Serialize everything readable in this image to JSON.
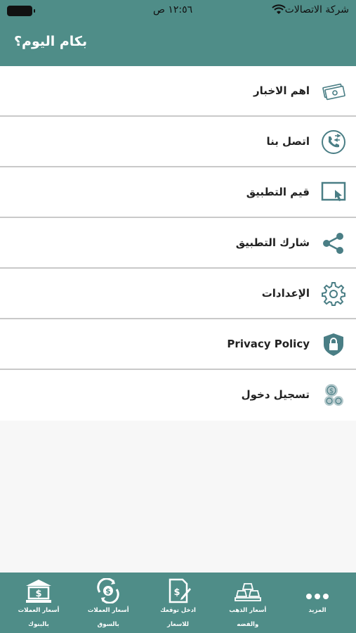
{
  "status": {
    "carrier": "شركة الاتصالات",
    "time": "١٢:٥٦ ص"
  },
  "header": {
    "title": "بكام اليوم؟"
  },
  "menu": [
    {
      "label": "اهم الاخبار",
      "icon": "money-icon"
    },
    {
      "label": "اتصل بنا",
      "icon": "phone-icon"
    },
    {
      "label": "قيم التطبيق",
      "icon": "rate-app-icon"
    },
    {
      "label": "شارك التطبيق",
      "icon": "share-icon"
    },
    {
      "label": "الإعدادات",
      "icon": "gear-icon"
    },
    {
      "label": "Privacy Policy",
      "icon": "shield-lock-icon"
    },
    {
      "label": "تسجيل دخول",
      "icon": "coins-icon"
    }
  ],
  "tabs": [
    {
      "line1": "أسعار العملات",
      "line2": "بالبنوك",
      "icon": "bank-icon"
    },
    {
      "line1": "أسعار العملات",
      "line2": "بالسوق",
      "icon": "currency-exchange-icon"
    },
    {
      "line1": "ادخل توقعك",
      "line2": "للاسعار",
      "icon": "document-edit-icon"
    },
    {
      "line1": "أسعار الذهب",
      "line2": "والفضه",
      "icon": "gold-bars-icon"
    },
    {
      "line1": "المزيد",
      "line2": "",
      "icon": "more-icon"
    }
  ],
  "colors": {
    "primary": "#4f8d88",
    "icon": "#4a7e85",
    "background": "#f7f7f7"
  }
}
